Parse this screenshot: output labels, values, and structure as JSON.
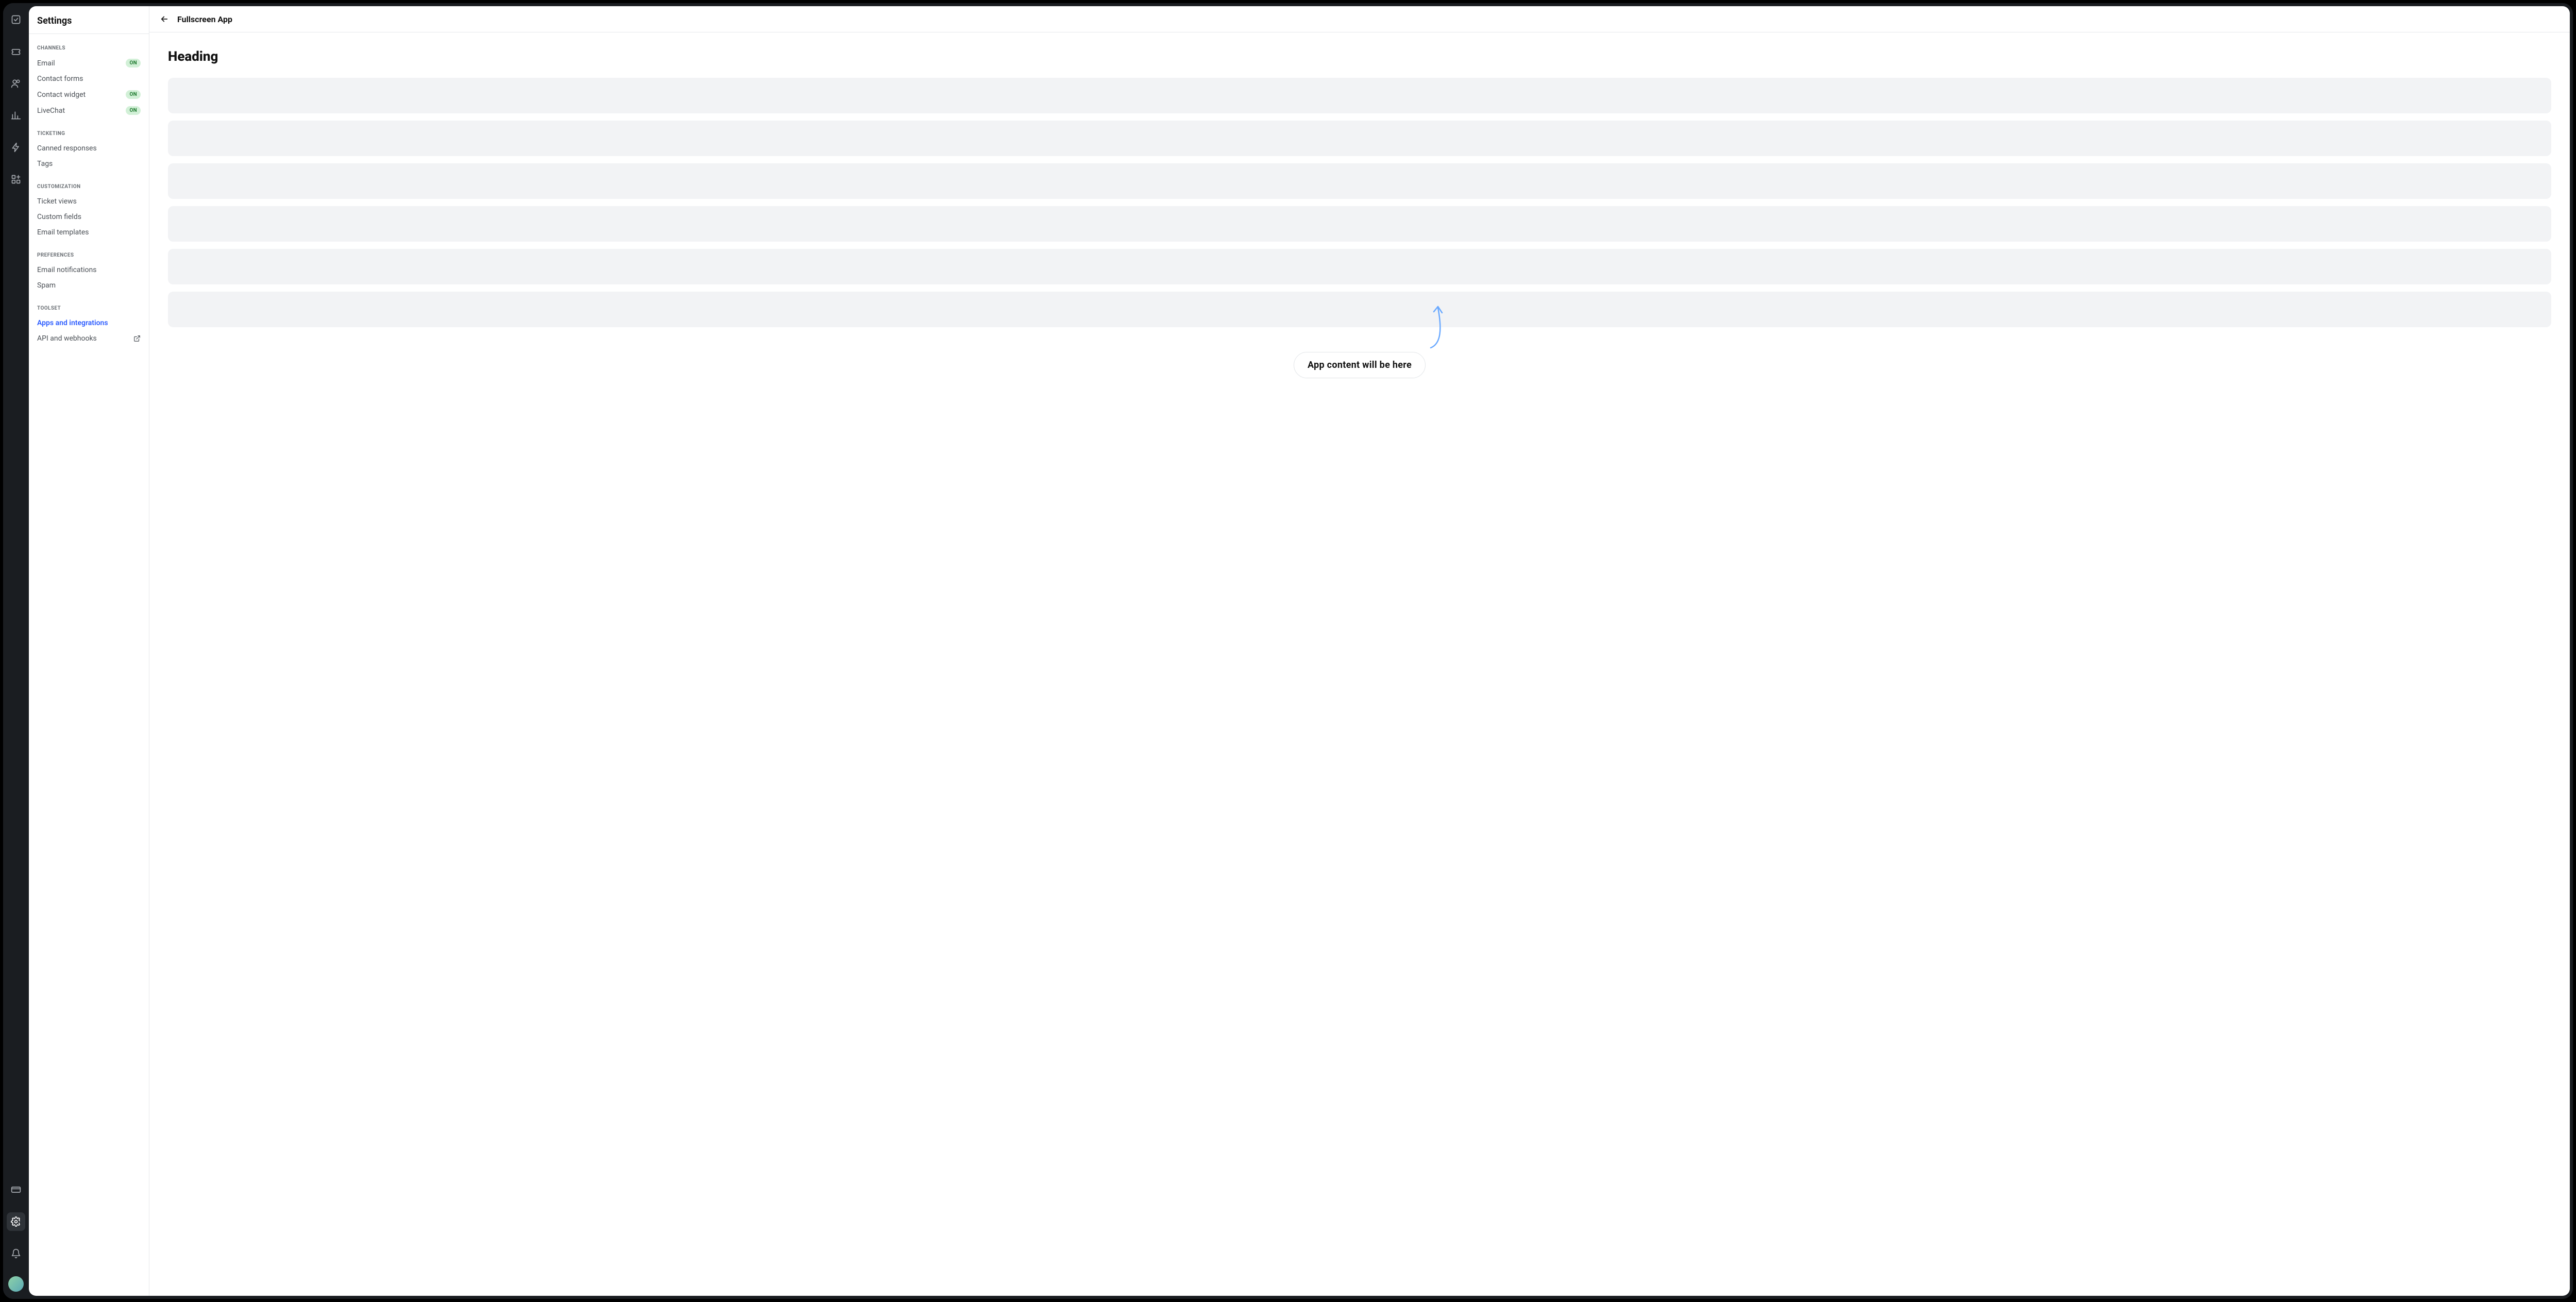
{
  "rail": {
    "icons": [
      "checkbox-icon",
      "ticket-icon",
      "users-icon",
      "analytics-icon",
      "automation-icon",
      "apps-grid-icon"
    ],
    "bottom_icons": [
      "billing-icon",
      "settings-icon",
      "notifications-icon",
      "avatar"
    ],
    "active_bottom": "settings-icon"
  },
  "sidebar": {
    "title": "Settings",
    "sections": [
      {
        "label": "CHANNELS",
        "items": [
          {
            "label": "Email",
            "badge": "ON"
          },
          {
            "label": "Contact forms",
            "badge": null
          },
          {
            "label": "Contact widget",
            "badge": "ON"
          },
          {
            "label": "LiveChat",
            "badge": "ON"
          }
        ]
      },
      {
        "label": "TICKETING",
        "items": [
          {
            "label": "Canned responses",
            "badge": null
          },
          {
            "label": "Tags",
            "badge": null
          }
        ]
      },
      {
        "label": "CUSTOMIZATION",
        "items": [
          {
            "label": "Ticket views",
            "badge": null
          },
          {
            "label": "Custom fields",
            "badge": null
          },
          {
            "label": "Email templates",
            "badge": null
          }
        ]
      },
      {
        "label": "PREFERENCES",
        "items": [
          {
            "label": "Email notifications",
            "badge": null
          },
          {
            "label": "Spam",
            "badge": null
          }
        ]
      },
      {
        "label": "TOOLSET",
        "items": [
          {
            "label": "Apps and integrations",
            "badge": null,
            "active": true
          },
          {
            "label": "API and webhooks",
            "badge": null,
            "external": true
          }
        ]
      }
    ]
  },
  "main": {
    "page_title": "Fullscreen App",
    "content_heading": "Heading",
    "placeholder_count": 6,
    "callout": "App content will be here"
  },
  "colors": {
    "accent": "#2c5cff",
    "badge_bg": "#d2f0d7",
    "badge_text": "#1f7a2f",
    "arrow": "#6aa9ff"
  }
}
